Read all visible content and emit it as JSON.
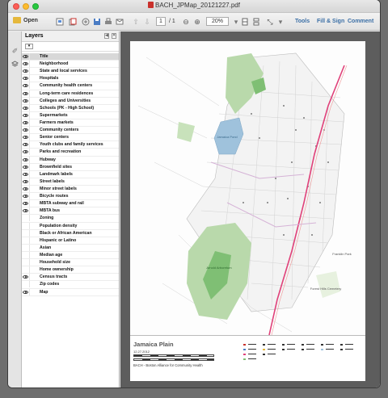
{
  "window": {
    "title": "BACH_JPMap_20121227.pdf"
  },
  "toolbar": {
    "open_label": "Open",
    "page_current": "1",
    "page_total": "/ 1",
    "zoom": "20%",
    "tools_label": "Tools",
    "fill_sign_label": "Fill & Sign",
    "comment_label": "Comment"
  },
  "layers_panel": {
    "title": "Layers",
    "items": [
      {
        "label": "Title",
        "visible": true
      },
      {
        "label": "Neighborhood",
        "visible": true
      },
      {
        "label": "State and local services",
        "visible": true
      },
      {
        "label": "Hospitals",
        "visible": true
      },
      {
        "label": "Community health centers",
        "visible": true
      },
      {
        "label": "Long-term care residences",
        "visible": true
      },
      {
        "label": "Colleges and Universities",
        "visible": true
      },
      {
        "label": "Schools (PK - High School)",
        "visible": true
      },
      {
        "label": "Supermarkets",
        "visible": true
      },
      {
        "label": "Farmers markets",
        "visible": true
      },
      {
        "label": "Community centers",
        "visible": true
      },
      {
        "label": "Senior centers",
        "visible": true
      },
      {
        "label": "Youth clubs and family services",
        "visible": true
      },
      {
        "label": "Parks and recreation",
        "visible": true
      },
      {
        "label": "Hubway",
        "visible": true
      },
      {
        "label": "Brownfield sites",
        "visible": true
      },
      {
        "label": "Landmark labels",
        "visible": true
      },
      {
        "label": "Street labels",
        "visible": true
      },
      {
        "label": "Minor street labels",
        "visible": true
      },
      {
        "label": "Bicycle routes",
        "visible": true
      },
      {
        "label": "MBTA subway and rail",
        "visible": true
      },
      {
        "label": "MBTA bus",
        "visible": true
      },
      {
        "label": "Zoning",
        "visible": false
      },
      {
        "label": "Population density",
        "visible": false
      },
      {
        "label": "Black or African American",
        "visible": false
      },
      {
        "label": "Hispanic or Latino",
        "visible": false
      },
      {
        "label": "Asian",
        "visible": false
      },
      {
        "label": "Median age",
        "visible": false
      },
      {
        "label": "Household size",
        "visible": false
      },
      {
        "label": "Home ownership",
        "visible": false
      },
      {
        "label": "Census tracts",
        "visible": true
      },
      {
        "label": "Zip codes",
        "visible": false
      },
      {
        "label": "Map",
        "visible": true
      }
    ]
  },
  "map": {
    "labels": {
      "pond": "Jamaica Pond",
      "arboretum": "Arnold Arboretum",
      "franklin_park": "Franklin Park",
      "forest_hills": "Forest Hills Cemetery"
    },
    "legend": {
      "title": "Jamaica Plain",
      "date": "12.27.2012",
      "credit": "BACH - Boston Alliance for Community Health"
    }
  },
  "colors": {
    "park": "#b9d9ab",
    "park_dark": "#6fb46a",
    "water": "#9fc2dc",
    "rail": "#e0417a",
    "bus": "#d5b2d6",
    "street": "#cfcfcf"
  }
}
